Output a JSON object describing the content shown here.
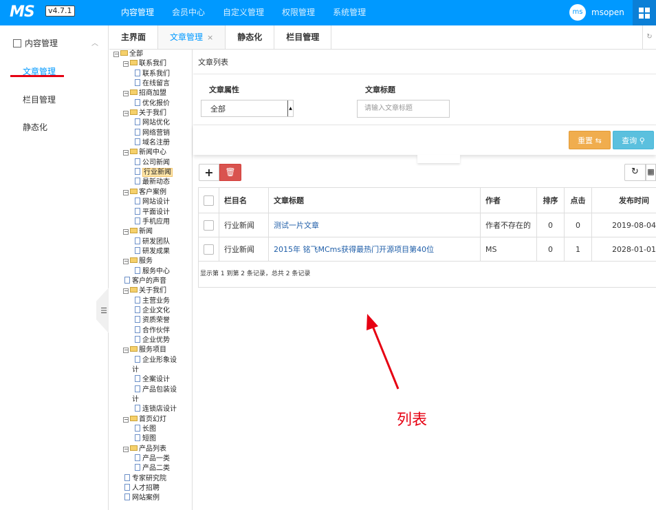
{
  "header": {
    "logo": "MS",
    "version": "v4.7.1",
    "nav": [
      "内容管理",
      "会员中心",
      "自定义管理",
      "权限管理",
      "系统管理"
    ],
    "avatar": "ms",
    "username": "msopen"
  },
  "sidebar": {
    "section": "内容管理",
    "items": [
      "文章管理",
      "栏目管理",
      "静态化"
    ]
  },
  "tabs": [
    {
      "label": "主界面"
    },
    {
      "label": "文章管理",
      "close": "×"
    },
    {
      "label": "静态化"
    },
    {
      "label": "栏目管理"
    }
  ],
  "tree": [
    {
      "label": "全部",
      "level": 0,
      "type": "folder"
    },
    {
      "label": "联系我们",
      "level": 1,
      "type": "folder"
    },
    {
      "label": "联系我们",
      "level": 2,
      "type": "file"
    },
    {
      "label": "在线留言",
      "level": 2,
      "type": "file"
    },
    {
      "label": "招商加盟",
      "level": 1,
      "type": "folder"
    },
    {
      "label": "优化报价",
      "level": 2,
      "type": "file"
    },
    {
      "label": "关于我们",
      "level": 1,
      "type": "folder"
    },
    {
      "label": "网站优化",
      "level": 2,
      "type": "file"
    },
    {
      "label": "网络营销",
      "level": 2,
      "type": "file"
    },
    {
      "label": "域名注册",
      "level": 2,
      "type": "file"
    },
    {
      "label": "新闻中心",
      "level": 1,
      "type": "folder"
    },
    {
      "label": "公司新闻",
      "level": 2,
      "type": "file"
    },
    {
      "label": "行业新闻",
      "level": 2,
      "type": "file",
      "selected": true
    },
    {
      "label": "最新动态",
      "level": 2,
      "type": "file"
    },
    {
      "label": "客户案例",
      "level": 1,
      "type": "folder"
    },
    {
      "label": "网站设计",
      "level": 2,
      "type": "file"
    },
    {
      "label": "平面设计",
      "level": 2,
      "type": "file"
    },
    {
      "label": "手机应用",
      "level": 2,
      "type": "file"
    },
    {
      "label": "新闻",
      "level": 1,
      "type": "folder"
    },
    {
      "label": "研发团队",
      "level": 2,
      "type": "file"
    },
    {
      "label": "研发成果",
      "level": 2,
      "type": "file"
    },
    {
      "label": "服务",
      "level": 1,
      "type": "folder"
    },
    {
      "label": "服务中心",
      "level": 2,
      "type": "file"
    },
    {
      "label": "客户的声音",
      "level": 1,
      "type": "file"
    },
    {
      "label": "关于我们",
      "level": 1,
      "type": "folder"
    },
    {
      "label": "主营业务",
      "level": 2,
      "type": "file"
    },
    {
      "label": "企业文化",
      "level": 2,
      "type": "file"
    },
    {
      "label": "资质荣誉",
      "level": 2,
      "type": "file"
    },
    {
      "label": "合作伙伴",
      "level": 2,
      "type": "file"
    },
    {
      "label": "企业优势",
      "level": 2,
      "type": "file"
    },
    {
      "label": "服务项目",
      "level": 1,
      "type": "folder"
    },
    {
      "label": "企业形象设",
      "level": 2,
      "type": "file"
    },
    {
      "label": "计",
      "level": -1,
      "type": "wrap"
    },
    {
      "label": "全案设计",
      "level": 2,
      "type": "file"
    },
    {
      "label": "产品包装设",
      "level": 2,
      "type": "file"
    },
    {
      "label": "计",
      "level": -1,
      "type": "wrap"
    },
    {
      "label": "连锁店设计",
      "level": 2,
      "type": "file"
    },
    {
      "label": "首页幻灯",
      "level": 1,
      "type": "folder"
    },
    {
      "label": "长图",
      "level": 2,
      "type": "file"
    },
    {
      "label": "短图",
      "level": 2,
      "type": "file"
    },
    {
      "label": "产品列表",
      "level": 1,
      "type": "folder"
    },
    {
      "label": "产品一类",
      "level": 2,
      "type": "file"
    },
    {
      "label": "产品二类",
      "level": 2,
      "type": "file"
    },
    {
      "label": "专家研究院",
      "level": 1,
      "type": "file"
    },
    {
      "label": "人才招聘",
      "level": 1,
      "type": "file"
    },
    {
      "label": "网站案例",
      "level": 1,
      "type": "file"
    }
  ],
  "panel": {
    "title": "文章列表",
    "filter_attr_label": "文章属性",
    "filter_attr_value": "全部",
    "filter_title_label": "文章标题",
    "filter_title_placeholder": "请输入文章标题",
    "reset_label": "重置",
    "query_label": "查询"
  },
  "table": {
    "columns": [
      "栏目名",
      "文章标题",
      "作者",
      "排序",
      "点击",
      "发布时间"
    ],
    "rows": [
      [
        "行业新闻",
        "测试一片文章",
        "作者不存在的",
        "0",
        "0",
        "2019-08-04"
      ],
      [
        "行业新闻",
        "2015年 铭飞MCms获得最热门开源项目第40位",
        "MS",
        "0",
        "1",
        "2028-01-01"
      ]
    ],
    "footer": "显示第 1 到第 2 条记录，总共 2 条记录"
  },
  "annotation": "列表",
  "colors": {
    "primary": "#0099ff",
    "annotation": "#e60012",
    "reset": "#f0ad4e",
    "query": "#5bc0de",
    "delete": "#d9534f"
  }
}
